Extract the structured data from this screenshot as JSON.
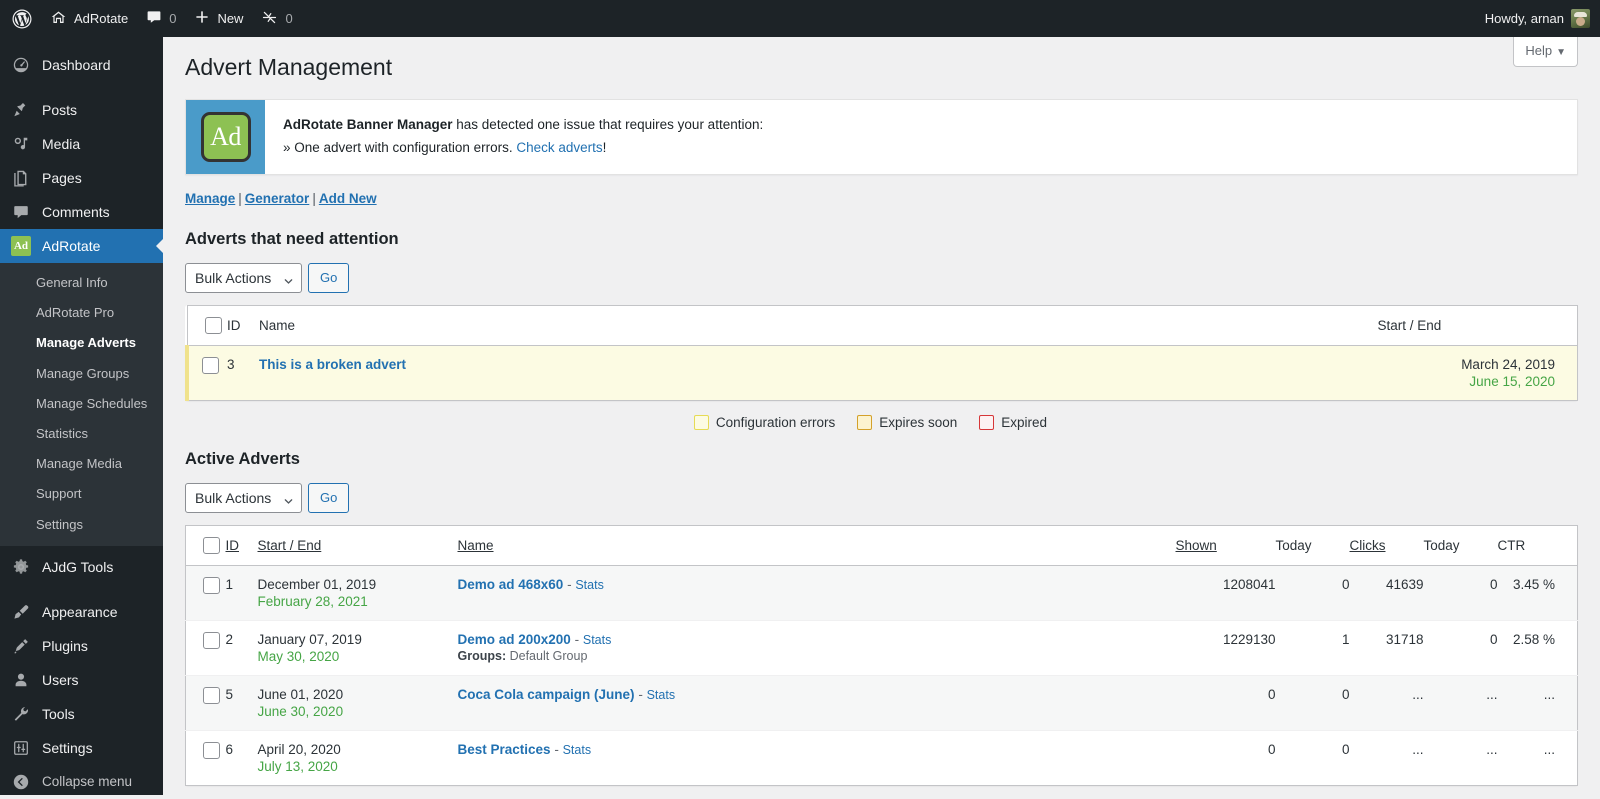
{
  "adminbar": {
    "wp_logo": "wordpress-logo",
    "site_name": "AdRotate",
    "comments_icon": "comment-icon",
    "comments_count": "0",
    "new_icon": "plus-icon",
    "new_label": "New",
    "plugin_icon": "jetpack-icon",
    "plugin_count": "0",
    "howdy": "Howdy, arnan",
    "avatar": "user-avatar"
  },
  "sidebar": {
    "items": [
      {
        "label": "Dashboard",
        "icon": "dashboard-icon",
        "current": false
      },
      {
        "label": "Posts",
        "icon": "pin-icon",
        "current": false
      },
      {
        "label": "Media",
        "icon": "media-icon",
        "current": false
      },
      {
        "label": "Pages",
        "icon": "pages-icon",
        "current": false
      },
      {
        "label": "Comments",
        "icon": "comment-icon",
        "current": false
      },
      {
        "label": "AdRotate",
        "icon": "adrotate-ad-icon",
        "current": true
      },
      {
        "label": "AJdG Tools",
        "icon": "gear-icon",
        "current": false
      },
      {
        "label": "Appearance",
        "icon": "brush-icon",
        "current": false
      },
      {
        "label": "Plugins",
        "icon": "plug-icon",
        "current": false
      },
      {
        "label": "Users",
        "icon": "user-icon",
        "current": false
      },
      {
        "label": "Tools",
        "icon": "wrench-icon",
        "current": false
      },
      {
        "label": "Settings",
        "icon": "settings-sliders-icon",
        "current": false
      },
      {
        "label": "Collapse menu",
        "icon": "collapse-arrow-icon",
        "current": false
      }
    ],
    "submenu": [
      {
        "label": "General Info",
        "current": false
      },
      {
        "label": "AdRotate Pro",
        "current": false
      },
      {
        "label": "Manage Adverts",
        "current": true
      },
      {
        "label": "Manage Groups",
        "current": false
      },
      {
        "label": "Manage Schedules",
        "current": false
      },
      {
        "label": "Statistics",
        "current": false
      },
      {
        "label": "Manage Media",
        "current": false
      },
      {
        "label": "Support",
        "current": false
      },
      {
        "label": "Settings",
        "current": false
      }
    ],
    "ad_icon_text": "Ad"
  },
  "help": {
    "label": "Help",
    "caret": "▼"
  },
  "page": {
    "title": "Advert Management"
  },
  "notice": {
    "logo_text": "Ad",
    "strong": "AdRotate Banner Manager",
    "line1_rest": " has detected one issue that requires your attention:",
    "line2_prefix": "» One advert with configuration errors. ",
    "line2_link": "Check adverts",
    "line2_suffix": "!"
  },
  "subnav": {
    "manage": "Manage",
    "generator": "Generator",
    "add_new": "Add New",
    "sep": "|"
  },
  "attention": {
    "title": "Adverts that need attention",
    "bulk_label": "Bulk Actions",
    "go_label": "Go",
    "headers": {
      "id": "ID",
      "name": "Name",
      "startend": "Start / End"
    },
    "rows": [
      {
        "id": "3",
        "name": "This is a broken advert",
        "start": "March 24, 2019",
        "end": "June 15, 2020"
      }
    ]
  },
  "legend": [
    {
      "label": "Configuration errors",
      "swatch": "cfg",
      "color": "#fcfbe3"
    },
    {
      "label": "Expires soon",
      "swatch": "soon",
      "color": "#fcf3cf"
    },
    {
      "label": "Expired",
      "swatch": "exp",
      "color": "#fdf2f2"
    }
  ],
  "active": {
    "title": "Active Adverts",
    "bulk_label": "Bulk Actions",
    "go_label": "Go",
    "headers": {
      "id": "ID",
      "startend": "Start / End",
      "name": "Name",
      "shown": "Shown",
      "shown_today": "Today",
      "clicks": "Clicks",
      "clicks_today": "Today",
      "ctr": "CTR"
    },
    "stats_label": "Stats",
    "dash": "-",
    "groups_label": "Groups:",
    "rows": [
      {
        "id": "1",
        "start": "December 01, 2019",
        "end": "February 28, 2021",
        "name": "Demo ad 468x60",
        "groups": "",
        "shown": "1208041",
        "shown_today": "0",
        "clicks": "41639",
        "clicks_today": "0",
        "ctr": "3.45 %"
      },
      {
        "id": "2",
        "start": "January 07, 2019",
        "end": "May 30, 2020",
        "name": "Demo ad 200x200",
        "groups": "Default Group",
        "shown": "1229130",
        "shown_today": "1",
        "clicks": "31718",
        "clicks_today": "0",
        "ctr": "2.58 %"
      },
      {
        "id": "5",
        "start": "June 01, 2020",
        "end": "June 30, 2020",
        "name": "Coca Cola campaign (June)",
        "groups": "",
        "shown": "0",
        "shown_today": "0",
        "clicks": "...",
        "clicks_today": "...",
        "ctr": "..."
      },
      {
        "id": "6",
        "start": "April 20, 2020",
        "end": "July 13, 2020",
        "name": "Best Practices",
        "groups": "",
        "shown": "0",
        "shown_today": "0",
        "clicks": "...",
        "clicks_today": "...",
        "ctr": "..."
      }
    ]
  },
  "colors": {
    "admin_bar": "#1d2327",
    "sidebar": "#1d2327",
    "accent": "#2271b1",
    "submenu_bg": "#2c3338",
    "logo_blue": "#4a9bc9",
    "logo_green": "#8dc153",
    "date_green": "#46a546",
    "attention_row": "#fcfbe3"
  }
}
